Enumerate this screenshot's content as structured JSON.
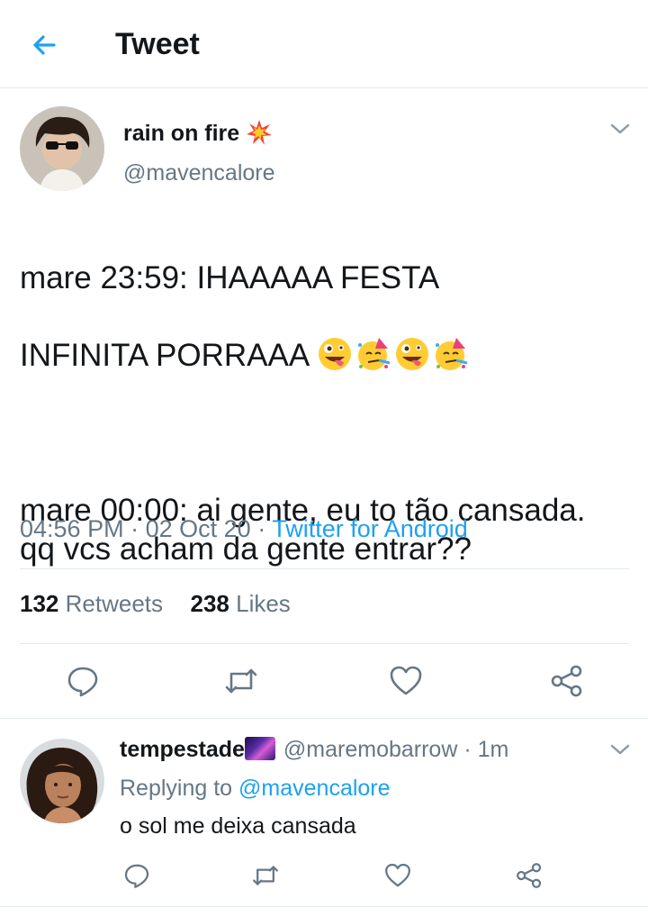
{
  "header": {
    "title": "Tweet",
    "back_icon": "arrow-left-icon",
    "accent": "#1da1f2"
  },
  "tweet": {
    "author_name": "rain on fire",
    "author_name_emoji": "collision-icon",
    "handle": "@mavencalore",
    "text_line1": "mare 23:59: IHAAAAA FESTA",
    "text_line2": "INFINITA PORRAAA",
    "text_emojis": [
      "zany-face-icon",
      "partying-face-icon",
      "zany-face-icon",
      "partying-face-icon"
    ],
    "text_para2": "mare 00:00: ai gente, eu to tão cansada. qq vcs acham da gente entrar??",
    "time": "04:56 PM",
    "date": "02 Oct 20",
    "source": "Twitter for Android",
    "separator": "·",
    "retweets_count": "132",
    "retweets_label": "Retweets",
    "likes_count": "238",
    "likes_label": "Likes",
    "actions": [
      "reply-icon",
      "retweet-icon",
      "like-icon",
      "share-icon"
    ]
  },
  "reply": {
    "author_name": "tempestade",
    "author_name_emoji": "milky-way-icon",
    "handle": "@maremobarrow",
    "separator": "·",
    "time": "1m",
    "replying_prefix": "Replying to",
    "replying_to": "@mavencalore",
    "text": "o sol me deixa cansada",
    "actions": [
      "reply-icon",
      "retweet-icon",
      "like-icon",
      "share-icon"
    ]
  },
  "colors": {
    "text": "#14171a",
    "secondary": "#657786",
    "link": "#1da1f2",
    "divider": "#e1e8ed"
  }
}
